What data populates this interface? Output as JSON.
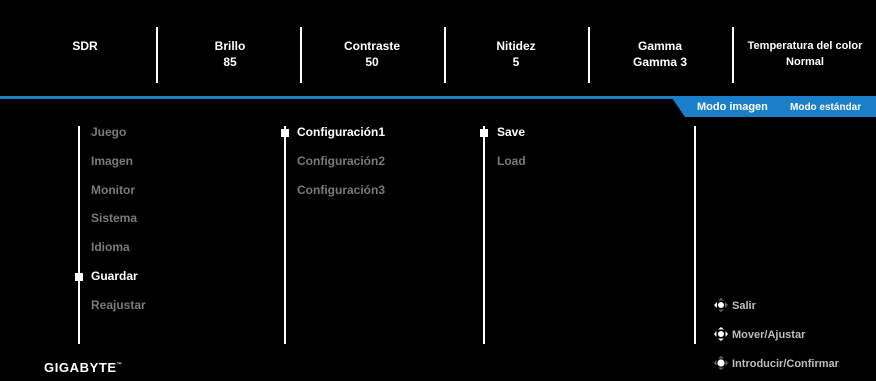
{
  "header": {
    "items": [
      {
        "label": "SDR",
        "value": ""
      },
      {
        "label": "Brillo",
        "value": "85"
      },
      {
        "label": "Contraste",
        "value": "50"
      },
      {
        "label": "Nitidez",
        "value": "5"
      },
      {
        "label": "Gamma",
        "value": "Gamma 3"
      },
      {
        "label": "Temperatura del color",
        "value": "Normal"
      }
    ]
  },
  "mode_tab": {
    "label": "Modo imagen",
    "value": "Modo estándar"
  },
  "menu": {
    "items": [
      "Juego",
      "Imagen",
      "Monitor",
      "Sistema",
      "Idioma",
      "Guardar",
      "Reajustar"
    ],
    "selected": "Guardar"
  },
  "submenu": {
    "items": [
      "Configuración1",
      "Configuración2",
      "Configuración3"
    ],
    "selected": "Configuración1"
  },
  "actions": {
    "items": [
      "Save",
      "Load"
    ],
    "selected": "Save"
  },
  "hints": {
    "exit": "Salir",
    "move": "Mover/Ajustar",
    "enter": "Introducir/Confirmar"
  },
  "brand": {
    "logo": "GIGABYTE",
    "tm": "™"
  },
  "colors": {
    "background": "#000000",
    "accent": "#1a7ec8",
    "text": "#ffffff",
    "muted": "#7a7a7a"
  }
}
